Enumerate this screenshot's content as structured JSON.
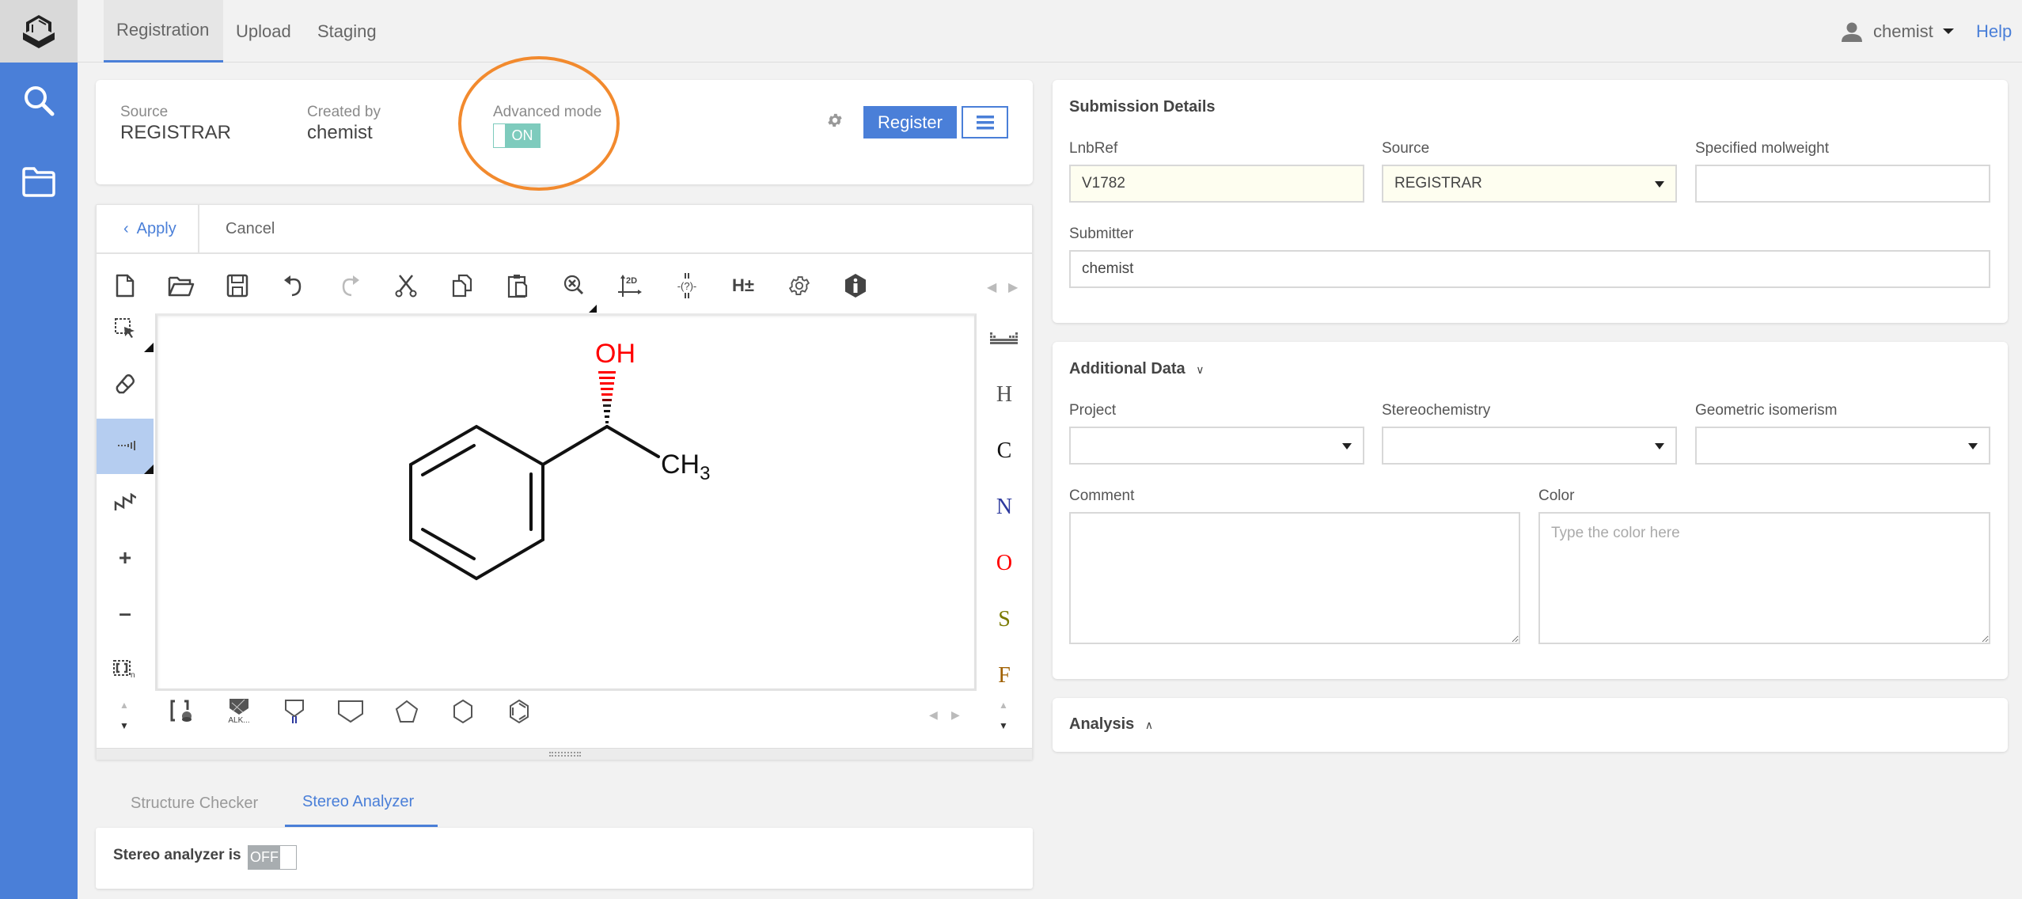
{
  "header": {
    "tabs": [
      {
        "label": "Registration",
        "active": true
      },
      {
        "label": "Upload",
        "active": false
      },
      {
        "label": "Staging",
        "active": false
      }
    ],
    "user": "chemist",
    "help": "Help"
  },
  "sidebar": {
    "items": [
      {
        "icon": "search-icon"
      },
      {
        "icon": "folder-icon"
      }
    ]
  },
  "summary": {
    "source_label": "Source",
    "source_value": "REGISTRAR",
    "created_label": "Created by",
    "created_value": "chemist",
    "advanced_label": "Advanced mode",
    "advanced_state": "ON",
    "register_label": "Register"
  },
  "editor": {
    "apply_label": "Apply",
    "cancel_label": "Cancel",
    "top_tools": [
      "new-document",
      "open",
      "save",
      "undo",
      "redo",
      "cut",
      "copy",
      "paste",
      "zoom-clear",
      "clean-2d",
      "query-atom",
      "toggle-hydrogens",
      "settings",
      "info"
    ],
    "left_tools": [
      "select",
      "erase",
      "bond",
      "chain",
      "charge-plus",
      "charge-minus",
      "s-group"
    ],
    "right_tools": [
      "periodic-table",
      "H",
      "C",
      "N",
      "O",
      "S",
      "F"
    ],
    "bottom_tools": [
      "template-library",
      "functional-groups",
      "cyclopropane",
      "cyclobutane",
      "cyclopentane",
      "cyclohexane",
      "benzene"
    ],
    "alk_label": "ALK...",
    "element_colors": {
      "H": "#555555",
      "C": "#111111",
      "N": "#2e3a9e",
      "O": "#ff0000",
      "S": "#7a7a00",
      "F": "#a06000"
    },
    "molecule": {
      "name": "(S)-1-phenylethanol",
      "labels": {
        "oh": "OH",
        "ch3": "CH",
        "ch3_sub": "3"
      }
    }
  },
  "bottom_tabs": [
    {
      "label": "Structure Checker",
      "active": false
    },
    {
      "label": "Stereo Analyzer",
      "active": true
    }
  ],
  "stereo": {
    "label": "Stereo analyzer is",
    "state": "OFF"
  },
  "submission": {
    "title": "Submission Details",
    "lnbref_label": "LnbRef",
    "lnbref_value": "V1782",
    "source_label": "Source",
    "source_value": "REGISTRAR",
    "molweight_label": "Specified molweight",
    "molweight_value": "",
    "submitter_label": "Submitter",
    "submitter_value": "chemist"
  },
  "additional": {
    "title": "Additional Data",
    "project_label": "Project",
    "project_value": "",
    "stereo_label": "Stereochemistry",
    "stereo_value": "",
    "geo_label": "Geometric isomerism",
    "geo_value": "",
    "comment_label": "Comment",
    "comment_value": "",
    "color_label": "Color",
    "color_placeholder": "Type the color here"
  },
  "analysis": {
    "title": "Analysis"
  },
  "colors": {
    "accent": "#4a7fd8",
    "toggle_on": "#7ecbbd",
    "toggle_off": "#a8adb0",
    "highlight": "#f28a2e"
  }
}
